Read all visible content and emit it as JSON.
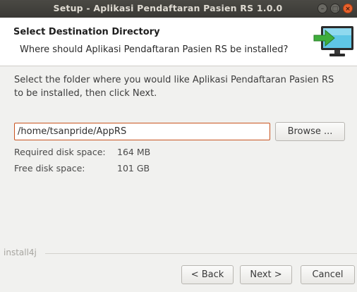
{
  "window": {
    "title": "Setup - Aplikasi Pendaftaran Pasien RS 1.0.0",
    "minimize": "–",
    "maximize": "□",
    "close": "×"
  },
  "header": {
    "title": "Select Destination Directory",
    "subtitle": "Where should Aplikasi Pendaftaran Pasien RS be installed?",
    "logo_icon": "install-computer-icon"
  },
  "body": {
    "description": "Select the folder where you would like Aplikasi Pendaftaran Pasien RS to be installed, then click Next.",
    "path_value": "/home/tsanpride/AppRS",
    "browse_label": "Browse ...",
    "required_label": "Required disk space:",
    "required_value": "164 MB",
    "free_label": "Free disk space:",
    "free_value": "101 GB"
  },
  "footer": {
    "brand": "install4j",
    "back_label": "< Back",
    "next_label": "Next >",
    "cancel_label": "Cancel"
  },
  "colors": {
    "titlebar": "#3f3e3a",
    "focus_border": "#c9531f",
    "close_button": "#e9622d",
    "monitor_screen": "#5fc6e6",
    "arrow": "#3fae3c"
  }
}
